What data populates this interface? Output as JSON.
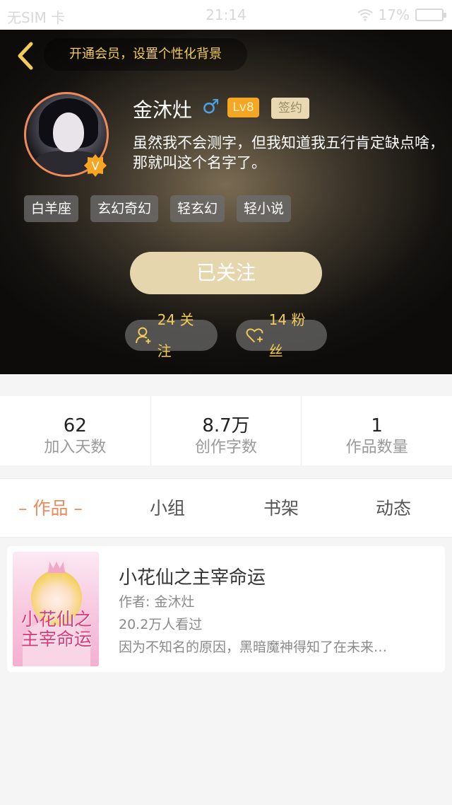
{
  "status_bar": {
    "carrier": "无SIM 卡",
    "time": "21:14",
    "battery": "17%"
  },
  "header": {
    "vip_prompt": "开通会员，设置个性化背景"
  },
  "profile": {
    "name": "金沐灶",
    "gender_symbol": "♂",
    "level": "Lv8",
    "signed_badge": "签约",
    "bio": "虽然我不会测字，但我知道我五行肯定缺点啥，那就叫这个名字了。",
    "tags": [
      "白羊座",
      "玄幻奇幻",
      "轻玄幻",
      "轻小说"
    ],
    "follow_button": "已关注",
    "following": "24 关注",
    "fans": "14 粉丝"
  },
  "stats": [
    {
      "value": "62",
      "label": "加入天数"
    },
    {
      "value": "8.7万",
      "label": "创作字数"
    },
    {
      "value": "1",
      "label": "作品数量"
    }
  ],
  "tabs": [
    "– 作品 –",
    "小组",
    "书架",
    "动态"
  ],
  "works": [
    {
      "title": "小花仙之主宰命运",
      "author": "作者: 金沐灶",
      "views": "20.2万人看过",
      "description": "因为不知名的原因，黑暗魔神得知了在未来…",
      "cover_title": "小花仙之主宰命运"
    }
  ],
  "colors": {
    "accent": "#f08a5a",
    "gold": "#f3cc55",
    "follow_button": "#e6d6ae",
    "level_badge": "#f5a623"
  }
}
